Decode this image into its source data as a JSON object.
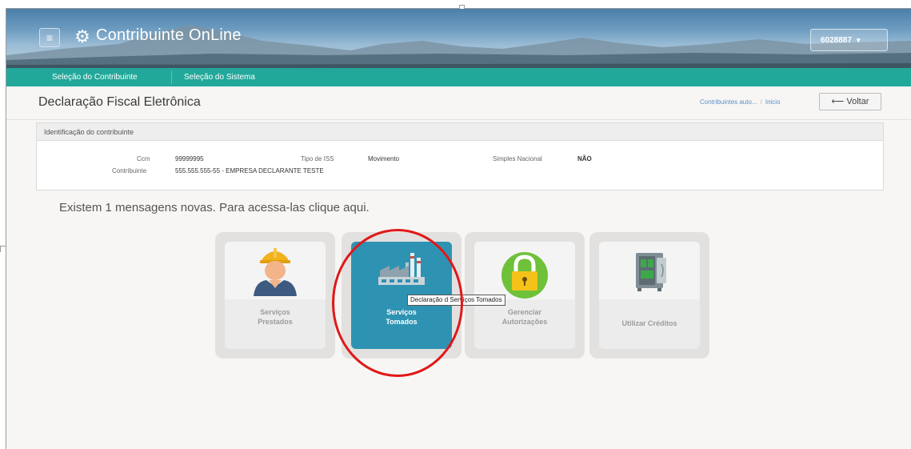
{
  "header": {
    "menu_icon": "hamburger-icon",
    "app_icon": "gear-icon",
    "title": "Contribuinte OnLine",
    "user_label": "6028887"
  },
  "nav": {
    "items": [
      {
        "label": "Seleção do Contribuinte"
      },
      {
        "label": "Seleção do Sistema"
      }
    ]
  },
  "page": {
    "title": "Declaração Fiscal Eletrônica",
    "breadcrumb": {
      "first": "Contribuintes auto...",
      "second": "Inicio"
    },
    "back_label": "Voltar",
    "back_icon": "arrow-left-icon"
  },
  "identification": {
    "heading": "Identificação do contribuinte",
    "ccm_label": "Ccm",
    "ccm_value": "99999995",
    "tipo_label": "Tipo de ISS",
    "tipo_value": "Movimento",
    "simples_label": "Simples Nacional",
    "simples_value": "NÃO",
    "contribuinte_label": "Contribuinte",
    "contribuinte_value": "555.555.555-55 - EMPRESA DECLARANTE TESTE"
  },
  "messages": {
    "text": "Existem 1 mensagens novas. Para acessa-las clique aqui."
  },
  "tiles": [
    {
      "line1": "Serviços",
      "line2": "Prestados",
      "icon": "worker-icon",
      "active": false
    },
    {
      "line1": "Serviços",
      "line2": "Tomados",
      "icon": "factory-icon",
      "active": true
    },
    {
      "line1": "Gerenciar",
      "line2": "Autorizações",
      "icon": "padlock-icon",
      "active": false
    },
    {
      "line1": "Utilizar Créditos",
      "line2": "",
      "icon": "safe-icon",
      "active": false
    }
  ],
  "tooltip": {
    "text": "Declaração d Serviços Tomados"
  },
  "colors": {
    "navbar": "#22a89a",
    "active_tile": "#2e93b3",
    "highlight": "#e01818"
  }
}
